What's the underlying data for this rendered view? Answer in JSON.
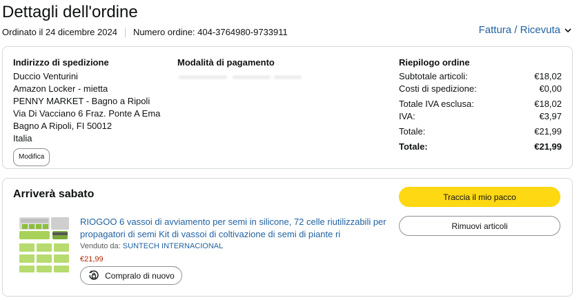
{
  "header": {
    "title": "Dettagli dell'ordine",
    "ordered_on": "Ordinato il 24 dicembre 2024",
    "order_number": "Numero ordine: 404-3764980-9733911",
    "invoice_label": "Fattura / Ricevuta"
  },
  "shipping": {
    "title": "Indirizzo di spedizione",
    "lines": [
      "Duccio Venturini",
      "Amazon Locker - mietta",
      "PENNY MARKET - Bagno a Ripoli",
      "Via Di Vacciano 6 Fraz. Ponte A Ema",
      "Bagno A Ripoli, FI 50012",
      "Italia"
    ],
    "edit_label": "Modifica"
  },
  "payment": {
    "title": "Modalità di pagamento"
  },
  "summary": {
    "title": "Riepilogo ordine",
    "rows": [
      {
        "label": "Subtotale articoli:",
        "value": "€18,02"
      },
      {
        "label": "Costi di spedizione:",
        "value": "€0,00"
      },
      {
        "label": "Totale IVA esclusa:",
        "value": "€18,02"
      },
      {
        "label": "IVA:",
        "value": "€3,97"
      },
      {
        "label": "Totale:",
        "value": "€21,99"
      },
      {
        "label": "Totale:",
        "value": "€21,99"
      }
    ]
  },
  "shipment": {
    "status": "Arriverà sabato",
    "track_label": "Traccia il mio pacco",
    "remove_label": "Rimuovi articoli",
    "product": {
      "title": "RIOGOO 6 vassoi di avviamento per semi in silicone, 72 celle riutilizzabili per propagatori di semi Kit di vassoi di coltivazione di semi di piante ri",
      "seller_prefix": "Venduto da:",
      "seller_name": "SUNTECH INTERNACIONAL",
      "price": "€21,99",
      "buy_again_label": "Compralo di nuovo"
    }
  },
  "colors": {
    "link": "#2162a1",
    "price": "#b12704",
    "primary_button": "#ffd814",
    "border": "#d5d9d9"
  },
  "icons": {
    "invoice_chevron": "chevron-down-icon",
    "buy_again": "reorder-bag-icon"
  }
}
